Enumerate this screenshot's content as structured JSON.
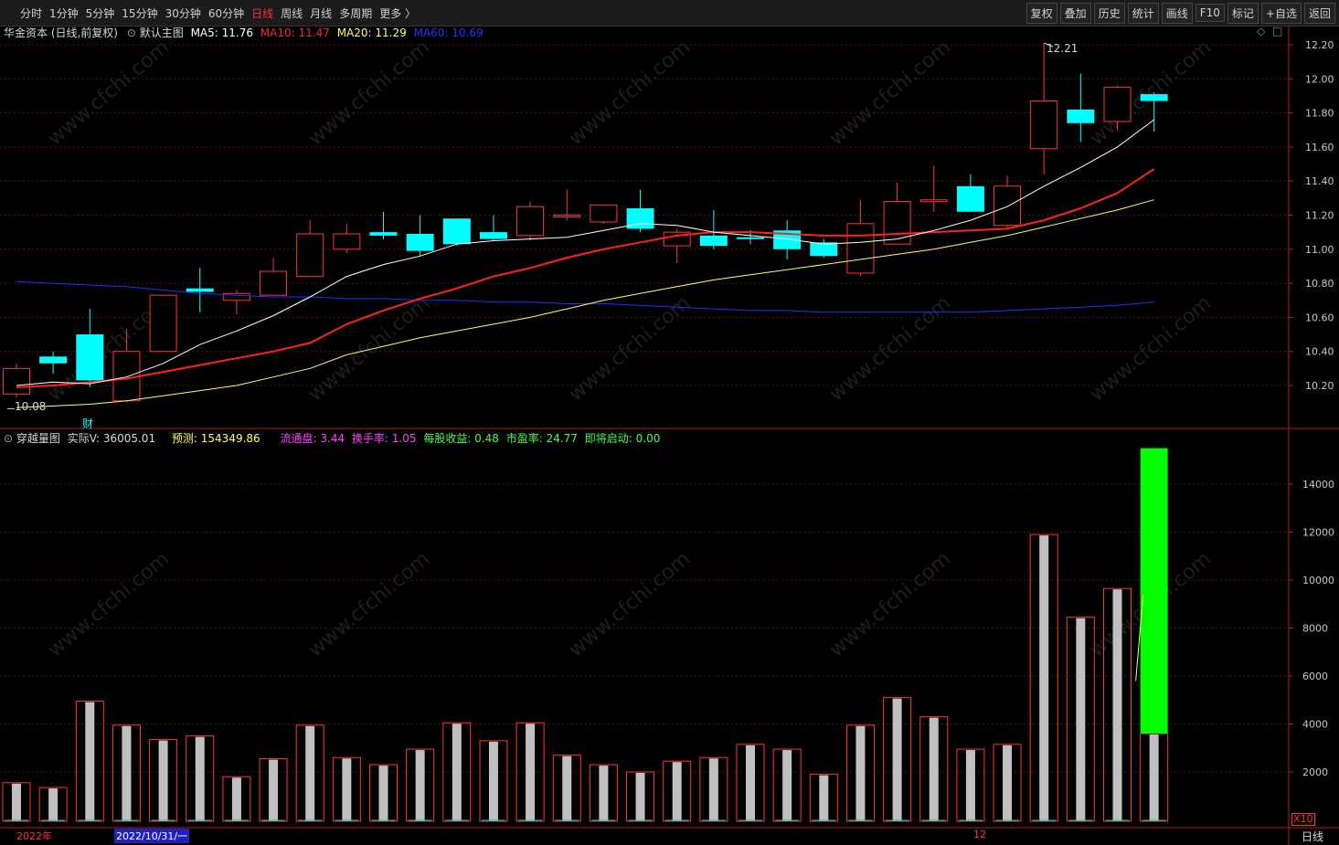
{
  "toolbar": {
    "periods": [
      "分时",
      "1分钟",
      "5分钟",
      "15分钟",
      "30分钟",
      "60分钟",
      "日线",
      "周线",
      "月线",
      "多周期",
      "更多 〉"
    ],
    "active_period": "日线",
    "tools": [
      "复权",
      "叠加",
      "历史",
      "统计",
      "画线",
      "F10",
      "标记",
      "+自选",
      "返回"
    ]
  },
  "main_legend": {
    "title": "华金资本 (日线,前复权)",
    "template": "默认主图",
    "ma5": "MA5: 11.76",
    "ma10": "MA10: 11.47",
    "ma20": "MA20: 11.29",
    "ma60": "MA60: 10.69",
    "high_label": "12.21",
    "low_label": "10.08",
    "fin_marker": "财"
  },
  "vol_legend": {
    "title": "穿越量图",
    "actual": "实际V: 36005.01",
    "forecast": "预测: 154349.86",
    "float": "流通盘: 3.44",
    "turnover": "换手率: 1.05",
    "eps": "每股收益: 0.48",
    "pe": "市盈率: 24.77",
    "start": "即将启动: 0.00"
  },
  "bottom": {
    "year": "2022年",
    "cursor_date": "2022/10/31/一",
    "month": "12",
    "x10": "X10",
    "period_tag": "日线"
  },
  "colors": {
    "up": "#ff3232",
    "down": "#00ffff",
    "ma5": "#ffffff",
    "ma10": "#ff2020",
    "ma20": "#ffff60",
    "ma60": "#2030ff",
    "volfill": "#c0c0c0",
    "forecast": "#00ff00"
  },
  "chart_data": {
    "type": "candlestick",
    "price_ticks": [
      "12.20",
      "12.00",
      "11.80",
      "11.60",
      "11.40",
      "11.20",
      "11.00",
      "10.80",
      "10.60",
      "10.40",
      "10.20"
    ],
    "vol_ticks": [
      "14000",
      "12000",
      "10000",
      "8000",
      "6000",
      "4000",
      "2000"
    ],
    "candles": [
      {
        "o": 10.15,
        "h": 10.33,
        "l": 10.13,
        "c": 10.3
      },
      {
        "o": 10.37,
        "h": 10.4,
        "l": 10.27,
        "c": 10.33
      },
      {
        "o": 10.5,
        "h": 10.65,
        "l": 10.19,
        "c": 10.23
      },
      {
        "o": 10.11,
        "h": 10.53,
        "l": 10.1,
        "c": 10.4
      },
      {
        "o": 10.4,
        "h": 10.73,
        "l": 10.4,
        "c": 10.73
      },
      {
        "o": 10.77,
        "h": 10.89,
        "l": 10.63,
        "c": 10.75
      },
      {
        "o": 10.7,
        "h": 10.76,
        "l": 10.62,
        "c": 10.74
      },
      {
        "o": 10.73,
        "h": 10.95,
        "l": 10.73,
        "c": 10.87
      },
      {
        "o": 10.84,
        "h": 11.17,
        "l": 10.84,
        "c": 11.09
      },
      {
        "o": 11.0,
        "h": 11.15,
        "l": 10.98,
        "c": 11.09
      },
      {
        "o": 11.1,
        "h": 11.22,
        "l": 11.06,
        "c": 11.08
      },
      {
        "o": 11.09,
        "h": 11.2,
        "l": 10.96,
        "c": 10.99
      },
      {
        "o": 11.18,
        "h": 11.18,
        "l": 11.02,
        "c": 11.03
      },
      {
        "o": 11.1,
        "h": 11.2,
        "l": 11.05,
        "c": 11.06
      },
      {
        "o": 11.08,
        "h": 11.28,
        "l": 11.05,
        "c": 11.25
      },
      {
        "o": 11.19,
        "h": 11.35,
        "l": 11.17,
        "c": 11.2
      },
      {
        "o": 11.16,
        "h": 11.26,
        "l": 11.15,
        "c": 11.26
      },
      {
        "o": 11.24,
        "h": 11.35,
        "l": 11.1,
        "c": 11.12
      },
      {
        "o": 11.02,
        "h": 11.12,
        "l": 10.92,
        "c": 11.1
      },
      {
        "o": 11.08,
        "h": 11.23,
        "l": 11.0,
        "c": 11.02
      },
      {
        "o": 11.07,
        "h": 11.11,
        "l": 11.03,
        "c": 11.06
      },
      {
        "o": 11.11,
        "h": 11.17,
        "l": 10.94,
        "c": 11.0
      },
      {
        "o": 11.04,
        "h": 11.06,
        "l": 10.95,
        "c": 10.96
      },
      {
        "o": 10.86,
        "h": 11.29,
        "l": 10.84,
        "c": 11.15
      },
      {
        "o": 11.03,
        "h": 11.39,
        "l": 11.03,
        "c": 11.28
      },
      {
        "o": 11.28,
        "h": 11.49,
        "l": 11.22,
        "c": 11.29
      },
      {
        "o": 11.37,
        "h": 11.44,
        "l": 11.22,
        "c": 11.22
      },
      {
        "o": 11.14,
        "h": 11.43,
        "l": 11.12,
        "c": 11.37
      },
      {
        "o": 11.59,
        "h": 12.21,
        "l": 11.44,
        "c": 11.87
      },
      {
        "o": 11.82,
        "h": 12.03,
        "l": 11.63,
        "c": 11.74
      },
      {
        "o": 11.75,
        "h": 11.96,
        "l": 11.7,
        "c": 11.95
      },
      {
        "o": 11.91,
        "h": 11.92,
        "l": 11.69,
        "c": 11.87
      }
    ],
    "ma5": [
      10.2,
      10.22,
      10.21,
      10.25,
      10.33,
      10.44,
      10.52,
      10.61,
      10.72,
      10.84,
      10.91,
      10.96,
      11.03,
      11.05,
      11.06,
      11.07,
      11.11,
      11.15,
      11.14,
      11.1,
      11.08,
      11.06,
      11.03,
      11.04,
      11.06,
      11.11,
      11.17,
      11.25,
      11.37,
      11.48,
      11.6,
      11.76
    ],
    "ma10": [
      10.19,
      10.2,
      10.22,
      10.24,
      10.28,
      10.32,
      10.36,
      10.4,
      10.45,
      10.56,
      10.64,
      10.71,
      10.77,
      10.84,
      10.89,
      10.95,
      11.0,
      11.04,
      11.08,
      11.1,
      11.1,
      11.09,
      11.08,
      11.08,
      11.09,
      11.1,
      11.11,
      11.12,
      11.17,
      11.24,
      11.33,
      11.47
    ],
    "ma20": [
      10.07,
      10.08,
      10.09,
      10.11,
      10.14,
      10.17,
      10.2,
      10.25,
      10.3,
      10.38,
      10.43,
      10.48,
      10.52,
      10.56,
      10.6,
      10.65,
      10.7,
      10.74,
      10.78,
      10.82,
      10.85,
      10.88,
      10.91,
      10.94,
      10.97,
      11.0,
      11.04,
      11.08,
      11.13,
      11.18,
      11.23,
      11.29
    ],
    "ma60": [
      10.81,
      10.8,
      10.79,
      10.78,
      10.76,
      10.74,
      10.73,
      10.72,
      10.72,
      10.71,
      10.71,
      10.7,
      10.7,
      10.69,
      10.69,
      10.68,
      10.68,
      10.67,
      10.66,
      10.65,
      10.64,
      10.64,
      10.63,
      10.63,
      10.63,
      10.63,
      10.63,
      10.64,
      10.65,
      10.66,
      10.67,
      10.69
    ],
    "volumes": [
      1550,
      1350,
      4950,
      3950,
      3350,
      3500,
      1800,
      2550,
      3950,
      2600,
      2300,
      2950,
      4050,
      3300,
      4050,
      2700,
      2300,
      2000,
      2450,
      2600,
      3150,
      2950,
      1900,
      3950,
      5100,
      4300,
      2950,
      3150,
      11900,
      8450,
      9650,
      3600
    ],
    "forecast_volume": 15500
  }
}
